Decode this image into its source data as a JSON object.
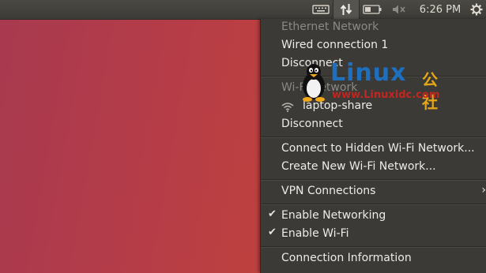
{
  "topbar": {
    "clock": "6:26 PM",
    "icons": [
      "keyboard-icon",
      "network-icon",
      "battery-icon",
      "volume-mute-icon",
      "gear-icon"
    ]
  },
  "menu": {
    "ethernet_header": "Ethernet Network",
    "wired_connection": "Wired connection 1",
    "ethernet_disconnect": "Disconnect",
    "wifi_header": "Wi-Fi Network",
    "wifi_network": "laptop-share",
    "wifi_disconnect": "Disconnect",
    "connect_hidden": "Connect to Hidden Wi-Fi Network...",
    "create_new": "Create New Wi-Fi Network...",
    "vpn": "VPN Connections",
    "enable_networking": "Enable Networking",
    "enable_networking_checked": true,
    "enable_wifi": "Enable Wi-Fi",
    "enable_wifi_checked": true,
    "connection_info": "Connection Information"
  },
  "watermark": {
    "brand": "Linux",
    "brand_cn": "公社",
    "url": "www.Linuxidc.com"
  }
}
